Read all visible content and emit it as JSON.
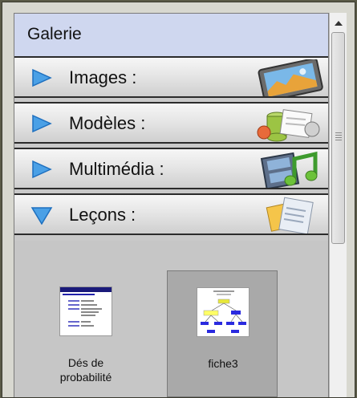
{
  "panel": {
    "title": "Galerie"
  },
  "sections": [
    {
      "label": "Images :",
      "icon": "image-icon",
      "expanded": false
    },
    {
      "label": "Modèles :",
      "icon": "templates-icon",
      "expanded": false
    },
    {
      "label": "Multimédia :",
      "icon": "multimedia-icon",
      "expanded": false
    },
    {
      "label": "Leçons :",
      "icon": "lessons-icon",
      "expanded": true
    }
  ],
  "lessons": [
    {
      "label_line1": "Dés de",
      "label_line2": "probabilité",
      "selected": false
    },
    {
      "label_line1": "fiche3",
      "label_line2": "",
      "selected": true
    }
  ],
  "colors": {
    "title_bg": "#cfd7ef",
    "arrow_blue": "#3c8fdc",
    "selected_tile": "#a9a9a9"
  }
}
